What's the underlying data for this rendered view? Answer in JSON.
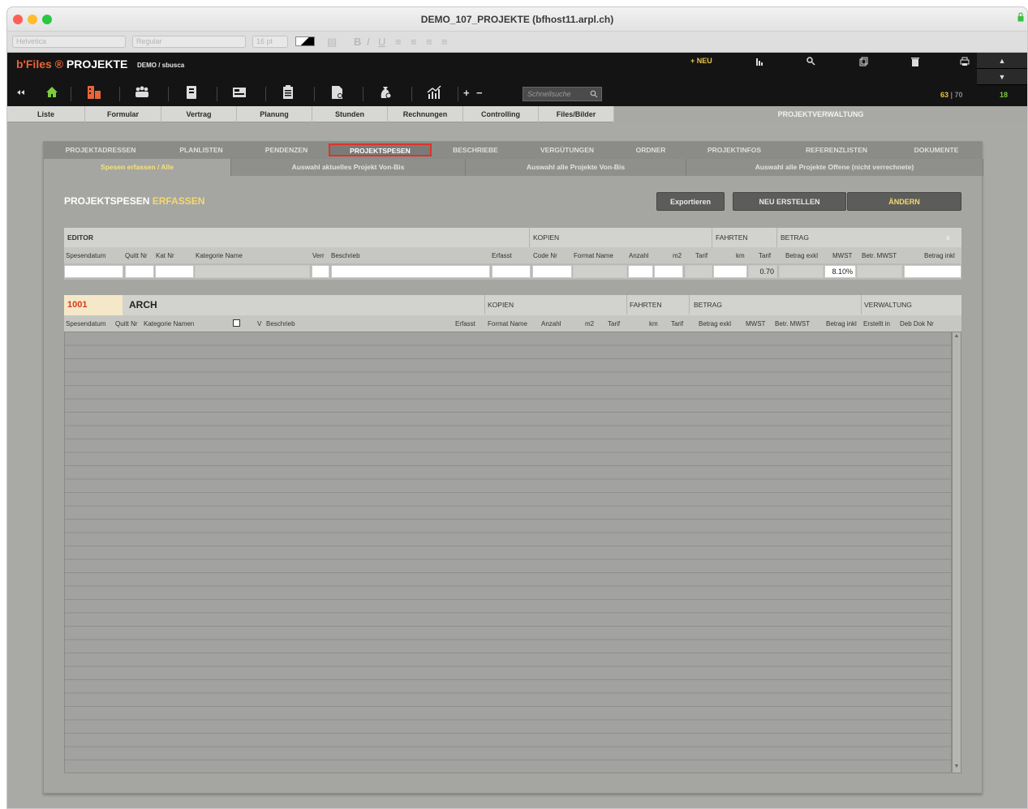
{
  "window": {
    "title": "DEMO_107_PROJEKTE (bfhost11.arpl.ch)"
  },
  "formatbar": {
    "font": "Helvetica",
    "style": "Regular",
    "size": "16 pt",
    "bold": "B",
    "italic": "I",
    "underline": "U"
  },
  "header": {
    "brand_prefix": "b'Files ®",
    "brand_name": "PROJEKTE",
    "breadcrumb": "DEMO / sbusca",
    "new_label": "+ NEU",
    "quicksearch_placeholder": "Schnellsuche",
    "counter_value": "63",
    "counter_total": "| 70",
    "counter_right": "18"
  },
  "modules": {
    "tabs": [
      "Liste",
      "Formular",
      "Vertrag",
      "Planung",
      "Stunden",
      "Rechnungen",
      "Controlling",
      "Files/Bilder"
    ],
    "active": "PROJEKTVERWALTUNG"
  },
  "subtabs": [
    "PROJEKTADRESSEN",
    "PLANLISTEN",
    "PENDENZEN",
    "PROJEKTSPESEN",
    "BESCHRIEBE",
    "VERGÜTUNGEN",
    "ORDNER",
    "PROJEKTINFOS",
    "REFERENZLISTEN",
    "DOKUMENTE"
  ],
  "subsubtabs": [
    "Spesen erfassen / Alle",
    "Auswahl aktuelles Projekt Von-Bis",
    "Auswahl alle Projekte Von-Bis",
    "Auswahl alle Projekte Offene (nicht verrechnete)"
  ],
  "page": {
    "heading_a": "PROJEKTSPESEN",
    "heading_b": "ERFASSEN",
    "export_button": "Exportieren",
    "new_button": "NEU ERSTELLEN",
    "edit_button": "ÄNDERN"
  },
  "editor": {
    "group_editor": "EDITOR",
    "group_kopien": "KOPIEN",
    "group_fahrten": "FAHRTEN",
    "group_betrag": "BETRAG",
    "close": "x",
    "columns": {
      "spesendatum": "Spesendatum",
      "quitt": "Quitt Nr",
      "kat": "Kat Nr",
      "katname": "Kategorie Name",
      "verr": "Verr",
      "beschrieb": "Beschrieb",
      "erfasst": "Erfasst",
      "code": "Code Nr",
      "format": "Format Name",
      "anzahl": "Anzahl",
      "m2": "m2",
      "tarif1": "Tarif",
      "km": "km",
      "tarif2": "Tarif",
      "betrag_exkl": "Betrag exkl",
      "mwst": "MWST",
      "betr_mwst": "Betr. MWST",
      "betrag_inkl": "Betrag inkl"
    },
    "values": {
      "tarif_km": "0.70",
      "mwst": "8.10%"
    }
  },
  "list": {
    "project_number": "1001",
    "project_name": "ARCH",
    "group_kopien": "KOPIEN",
    "group_fahrten": "FAHRTEN",
    "group_betrag": "BETRAG",
    "group_verwaltung": "VERWALTUNG",
    "columns": {
      "spesendatum": "Spesendatum",
      "quitt": "Quitt Nr",
      "katname": "Kategorie Namen",
      "v": "V",
      "beschrieb": "Beschrieb",
      "erfasst": "Erfasst",
      "format": "Format Name",
      "anzahl": "Anzahl",
      "m2": "m2",
      "tarif1": "Tarif",
      "km": "km",
      "tarif2": "Tarif",
      "betrag_exkl": "Betrag exkl",
      "mwst": "MWST",
      "betr_mwst": "Betr. MWST",
      "betrag_inkl": "Betrag inkl",
      "erstellt": "Erstellt in",
      "deb": "Deb Dok Nr"
    }
  },
  "colors": {
    "brand_accent": "#e8643a",
    "highlight_yellow": "#f3d872",
    "selected_tab_border": "#e0322a",
    "project_number": "#d43a1a"
  }
}
